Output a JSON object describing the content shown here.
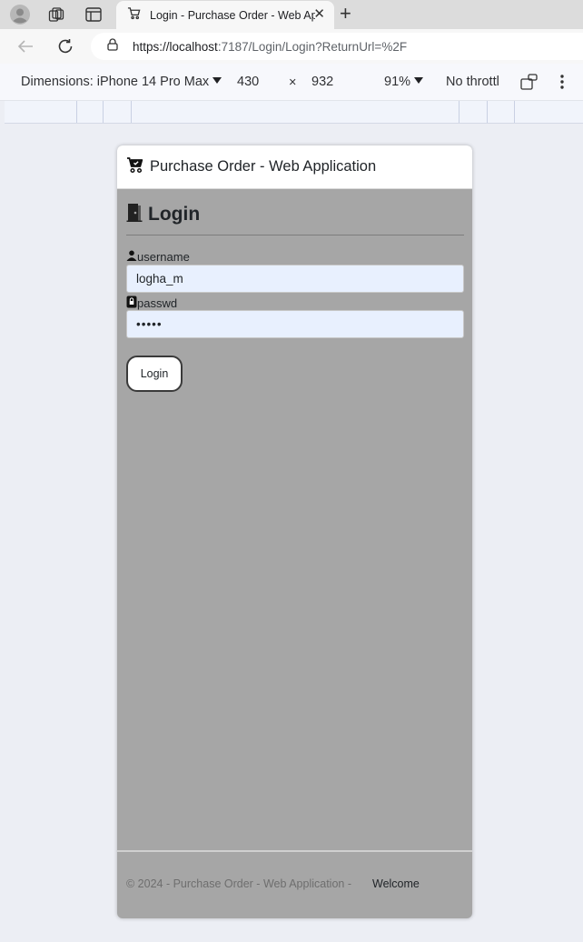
{
  "browser": {
    "tab": {
      "title": "Login - Purchase Order - Web Application"
    },
    "url": {
      "host": "https://localhost",
      "rest": ":7187/Login/Login?ReturnUrl=%2F"
    }
  },
  "devtools": {
    "device_label": "Dimensions: iPhone 14 Pro Max",
    "width": "430",
    "times": "×",
    "height": "932",
    "zoom": "91%",
    "throttle": "No throttl"
  },
  "app": {
    "title": "Purchase Order - Web Application",
    "login_heading": "Login",
    "username": {
      "label": "username",
      "value": "logha_m"
    },
    "password": {
      "label": "passwd",
      "value": "•••••"
    },
    "login_button": "Login",
    "footer": {
      "copyright": "© 2024 - Purchase Order - Web Application -",
      "welcome": "Welcome"
    }
  }
}
